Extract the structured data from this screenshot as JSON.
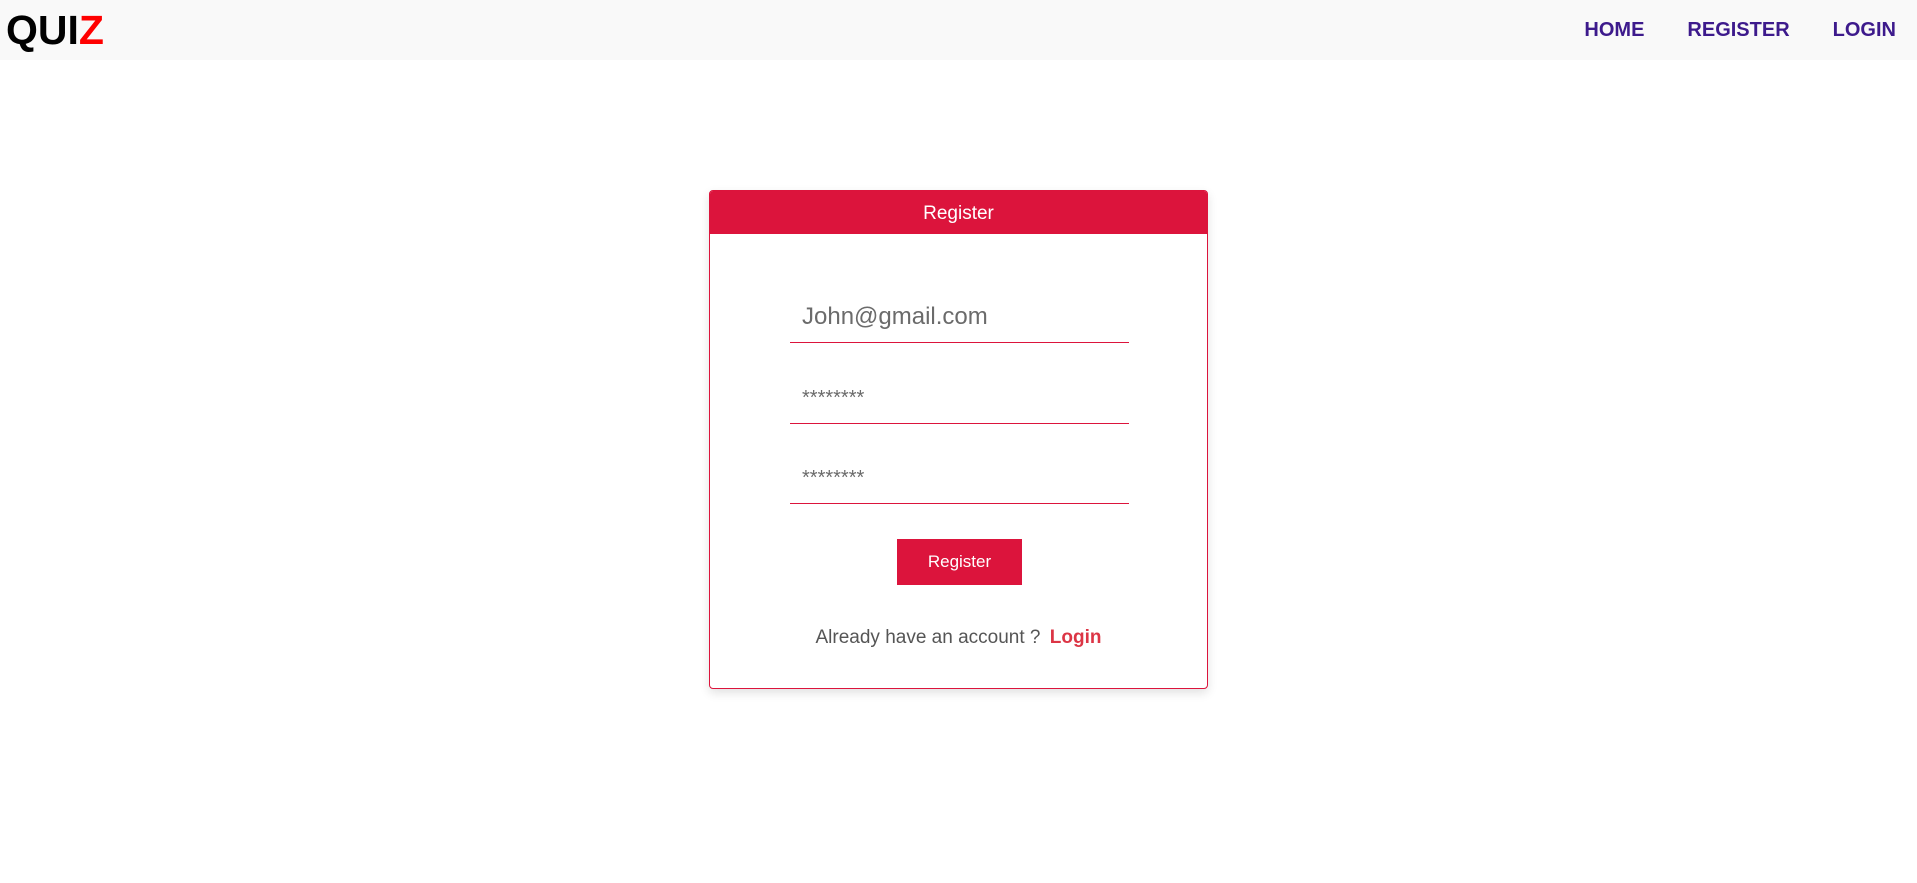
{
  "navbar": {
    "brand_part1": "QUI",
    "brand_part2": "Z",
    "links": [
      "HOME",
      "REGISTER",
      "LOGIN"
    ]
  },
  "form": {
    "title": "Register",
    "email_placeholder": "John@gmail.com",
    "password_placeholder": "********",
    "confirm_placeholder": "********",
    "submit_label": "Register",
    "footer_text": "Already have an account ?",
    "footer_link": "Login"
  },
  "colors": {
    "accent": "#dc143c",
    "nav_link": "#3d1a8c",
    "brand_highlight": "#ff0000",
    "navbar_bg": "#f9f9f9"
  }
}
